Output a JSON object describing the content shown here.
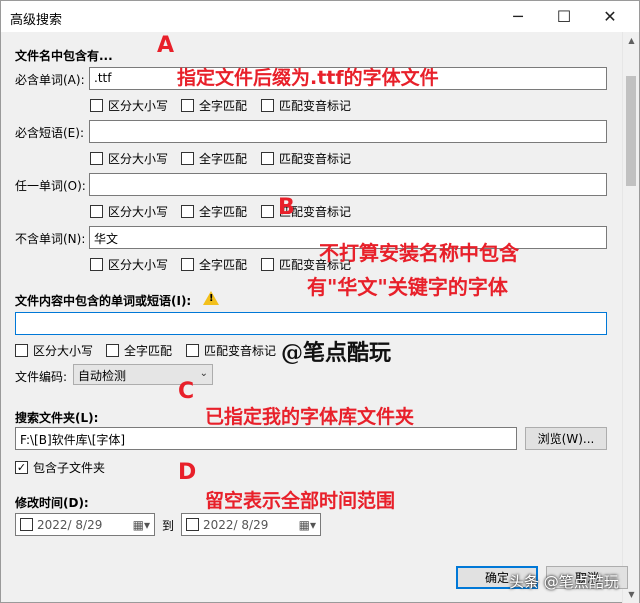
{
  "window": {
    "title": "高级搜索",
    "min_glyph": "─",
    "max_glyph": "☐",
    "close_glyph": "✕"
  },
  "filename_section": {
    "title": "文件名中包含有...",
    "must_word_label": "必含单词(A):",
    "must_word_value": ".ttf",
    "must_phrase_label": "必含短语(E):",
    "must_phrase_value": "",
    "any_word_label": "任一单词(O):",
    "any_word_value": "",
    "exclude_word_label": "不含单词(N):",
    "exclude_word_value": "华文",
    "opt_case": "区分大小写",
    "opt_whole": "全字匹配",
    "opt_diacritic": "匹配变音标记"
  },
  "content_section": {
    "title": "文件内容中包含的单词或短语(I):",
    "value": "",
    "opt_case": "区分大小写",
    "opt_whole": "全字匹配",
    "opt_diacritic": "匹配变音标记",
    "encoding_label": "文件编码:",
    "encoding_value": "自动检测"
  },
  "folder_section": {
    "title": "搜索文件夹(L):",
    "path": "F:\\[B]软件库\\[字体]",
    "browse": "浏览(W)...",
    "include_sub": "包含子文件夹",
    "include_sub_checked": true
  },
  "time_section": {
    "title": "修改时间(D):",
    "from_date": "2022/  8/29",
    "to_label": "到",
    "to_date": "2022/  8/29"
  },
  "footer": {
    "ok": "确定",
    "cancel": "取消"
  },
  "annotations": {
    "a_letter": "A",
    "a_text": "指定文件后缀为.ttf的字体文件",
    "b_letter": "B",
    "b_text_line1": "不打算安装名称中包含",
    "b_text_line2": "有\"华文\"关键字的字体",
    "c_letter": "C",
    "c_text": "已指定我的字体库文件夹",
    "d_letter": "D",
    "d_text": "留空表示全部时间范围",
    "brand": "@笔点酷玩",
    "watermark": "头条 @笔点酷玩"
  },
  "colors": {
    "annotation": "#e8202a",
    "focus_border": "#0078d7",
    "dialog_bg": "#f0f0f0"
  }
}
